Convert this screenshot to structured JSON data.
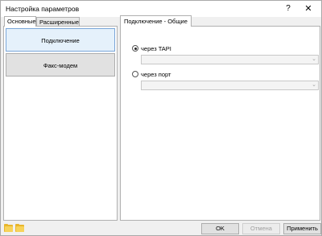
{
  "window": {
    "title": "Настройка параметров",
    "help_label": "?",
    "close_label": "✕"
  },
  "left_tabs": [
    {
      "label": "Основные",
      "active": true
    },
    {
      "label": "Расширенные",
      "active": false
    }
  ],
  "nav_items": [
    {
      "label": "Подключение",
      "selected": true
    },
    {
      "label": "Факс-модем",
      "selected": false
    }
  ],
  "right_tab": {
    "label": "Подключение - Общие"
  },
  "connection": {
    "tapi_label": "через TAPI",
    "tapi_checked": true,
    "tapi_value": "",
    "port_label": "через порт",
    "port_checked": false,
    "port_value": ""
  },
  "footer": {
    "ok_label": "OK",
    "cancel_label": "Отмена",
    "apply_label": "Применить"
  },
  "colors": {
    "folder": "#e8b62c",
    "selected_nav": "#e5f1fb"
  }
}
